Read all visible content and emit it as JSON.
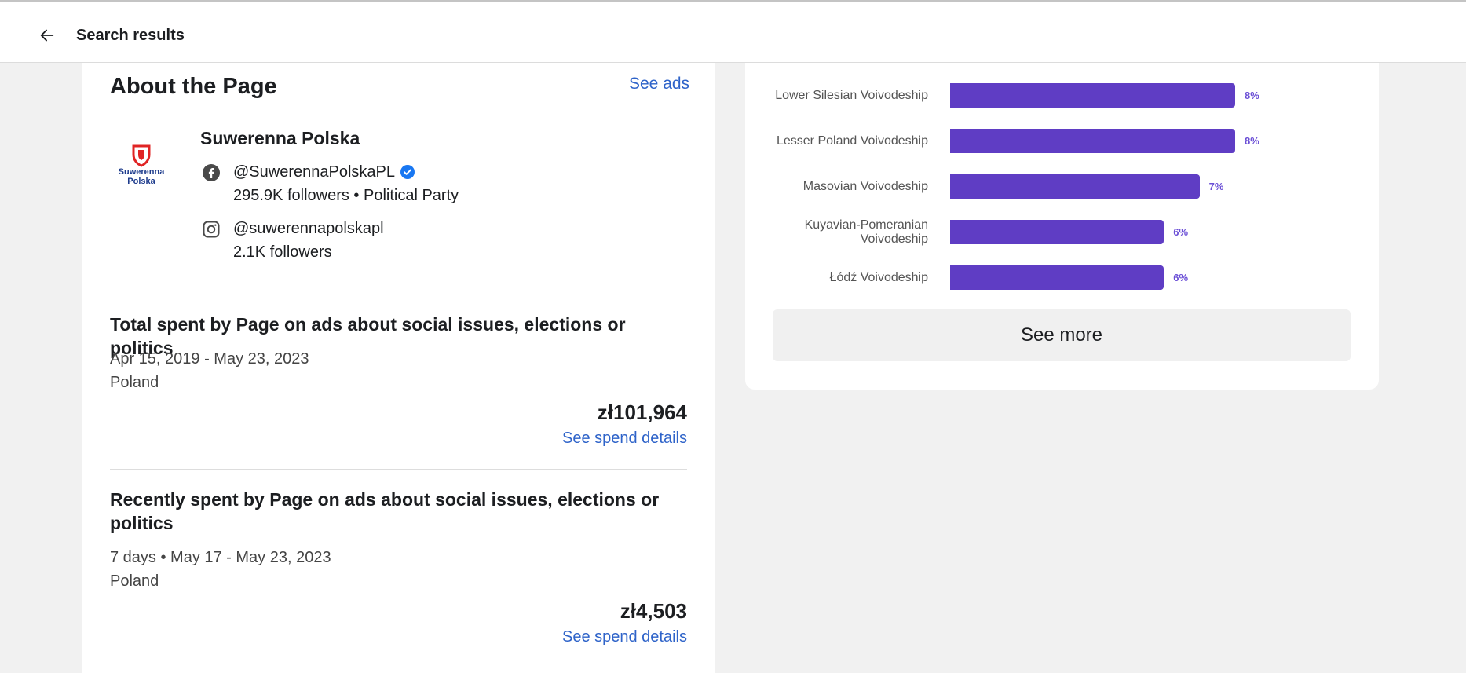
{
  "header": {
    "title": "Search results",
    "back_icon": "arrow-left-icon"
  },
  "about": {
    "title": "About the Page",
    "see_ads_label": "See ads",
    "logo": {
      "line1": "Suwerenna",
      "line2": "Polska",
      "accent_color": "#e02424",
      "brand_color": "#1d3b8c"
    },
    "page_name": "Suwerenna Polska",
    "facebook": {
      "icon": "facebook-icon",
      "handle": "@SuwerennaPolskaPL",
      "verified": true,
      "details": "295.9K followers • Political Party"
    },
    "instagram": {
      "icon": "instagram-icon",
      "handle": "@suwerennapolskapl",
      "details": "2.1K followers"
    }
  },
  "total_spent": {
    "title": "Total spent by Page on ads about social issues, elections or politics",
    "date_range": "Apr 15, 2019 - May 23, 2023",
    "region": "Poland",
    "amount": "zł101,964",
    "link_label": "See spend details"
  },
  "recent_spent": {
    "title": "Recently spent by Page on ads about social issues, elections or politics",
    "date_range": "7 days • May 17 - May 23, 2023",
    "region": "Poland",
    "amount": "zł4,503",
    "link_label": "See spend details"
  },
  "chart_data": {
    "type": "bar",
    "orientation": "horizontal",
    "categories": [
      "Lower Silesian Voivodeship",
      "Lesser Poland Voivodeship",
      "Masovian Voivodeship",
      "Kuyavian-Pomeranian Voivodeship",
      "Łódź Voivodeship"
    ],
    "values": [
      8,
      8,
      7,
      6,
      6
    ],
    "value_labels": [
      "8%",
      "8%",
      "7%",
      "6%",
      "6%"
    ],
    "unit": "%",
    "bar_color": "#5f3dc4",
    "label_color": "#6b4fd6"
  },
  "chart_footer": {
    "see_more_label": "See more"
  }
}
